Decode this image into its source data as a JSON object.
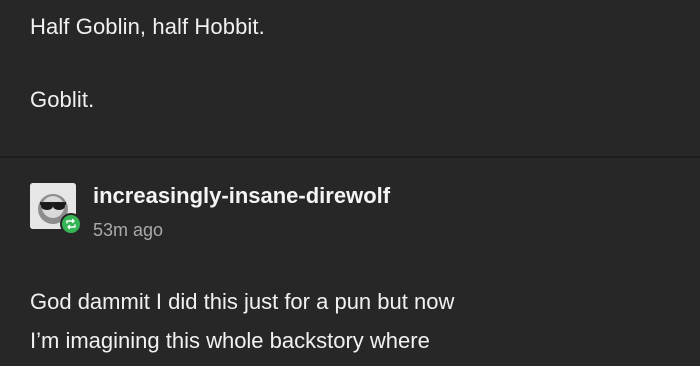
{
  "post": {
    "line1": "Half Goblin, half Hobbit.",
    "line2": "Goblit."
  },
  "reblog": {
    "username": "increasingly-insane-direwolf",
    "timestamp": "53m ago",
    "avatar_icon": "sunglasses-avatar-icon",
    "badge_icon": "reblog-icon",
    "badge_color": "#35b556",
    "body_lines": [
      "God dammit I did this just for a pun but now",
      "I’m imagining this whole backstory where"
    ]
  },
  "colors": {
    "background": "#272727",
    "text": "#f1f1f1",
    "muted_text": "#a9a9a9"
  }
}
